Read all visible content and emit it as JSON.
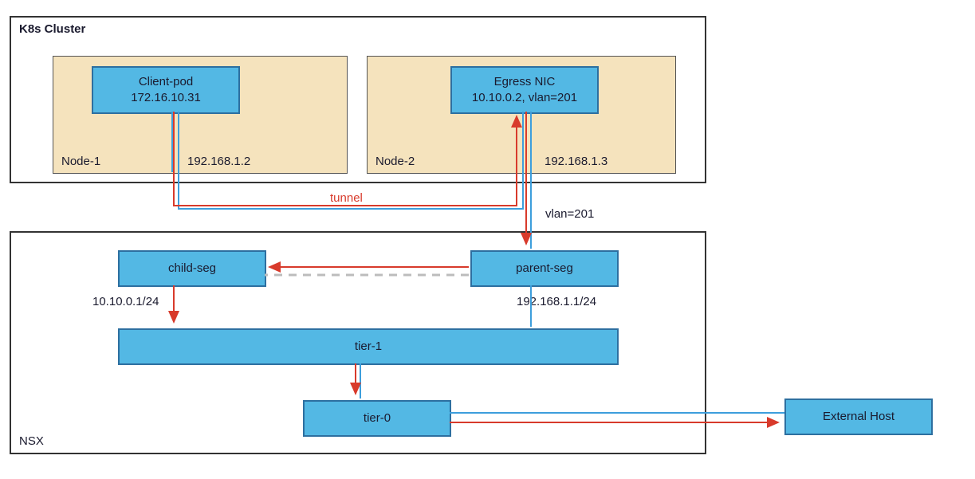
{
  "k8s": {
    "title": "K8s Cluster",
    "node1": {
      "label": "Node-1",
      "ip": "192.168.1.2",
      "pod": {
        "title": "Client-pod",
        "ip": "172.16.10.31"
      }
    },
    "node2": {
      "label": "Node-2",
      "ip": "192.168.1.3",
      "nic": {
        "title": "Egress NIC",
        "detail": "10.10.0.2, vlan=201"
      }
    }
  },
  "mid": {
    "tunnel_label": "tunnel",
    "vlan_label": "vlan=201"
  },
  "nsx": {
    "title": "NSX",
    "child_seg": {
      "label": "child-seg",
      "ip": "10.10.0.1/24"
    },
    "parent_seg": {
      "label": "parent-seg",
      "ip": "192.168.1.1/24"
    },
    "tier1": "tier-1",
    "tier0": "tier-0"
  },
  "external": "External Host",
  "chart_data": {
    "type": "diagram",
    "nodes": [
      {
        "id": "k8s-cluster",
        "label": "K8s Cluster",
        "type": "container"
      },
      {
        "id": "node-1",
        "label": "Node-1",
        "parent": "k8s-cluster",
        "ip": "192.168.1.2"
      },
      {
        "id": "node-2",
        "label": "Node-2",
        "parent": "k8s-cluster",
        "ip": "192.168.1.3"
      },
      {
        "id": "client-pod",
        "label": "Client-pod",
        "parent": "node-1",
        "ip": "172.16.10.31"
      },
      {
        "id": "egress-nic",
        "label": "Egress NIC",
        "parent": "node-2",
        "detail": "10.10.0.2, vlan=201"
      },
      {
        "id": "nsx",
        "label": "NSX",
        "type": "container"
      },
      {
        "id": "child-seg",
        "label": "child-seg",
        "parent": "nsx",
        "ip": "10.10.0.1/24"
      },
      {
        "id": "parent-seg",
        "label": "parent-seg",
        "parent": "nsx",
        "ip": "192.168.1.1/24"
      },
      {
        "id": "tier-1",
        "label": "tier-1",
        "parent": "nsx"
      },
      {
        "id": "tier-0",
        "label": "tier-0",
        "parent": "nsx"
      },
      {
        "id": "external-host",
        "label": "External Host"
      }
    ],
    "edges": [
      {
        "from": "client-pod",
        "to": "egress-nic",
        "label": "tunnel",
        "color": "red"
      },
      {
        "from": "egress-nic",
        "to": "parent-seg",
        "label": "vlan=201",
        "color": "red"
      },
      {
        "from": "parent-seg",
        "to": "child-seg",
        "color": "red"
      },
      {
        "from": "child-seg",
        "to": "tier-1",
        "color": "red"
      },
      {
        "from": "tier-1",
        "to": "tier-0",
        "color": "red"
      },
      {
        "from": "tier-0",
        "to": "external-host",
        "color": "red"
      },
      {
        "from": "client-pod",
        "to": "node-1-port",
        "color": "blue"
      },
      {
        "from": "egress-nic",
        "to": "parent-seg",
        "color": "blue"
      },
      {
        "from": "parent-seg",
        "to": "tier-1",
        "color": "blue"
      },
      {
        "from": "tier-1",
        "to": "tier-0",
        "color": "blue"
      },
      {
        "from": "tier-0",
        "to": "external-host",
        "color": "blue"
      },
      {
        "from": "parent-seg",
        "to": "child-seg",
        "style": "dashed",
        "color": "gray"
      }
    ]
  }
}
